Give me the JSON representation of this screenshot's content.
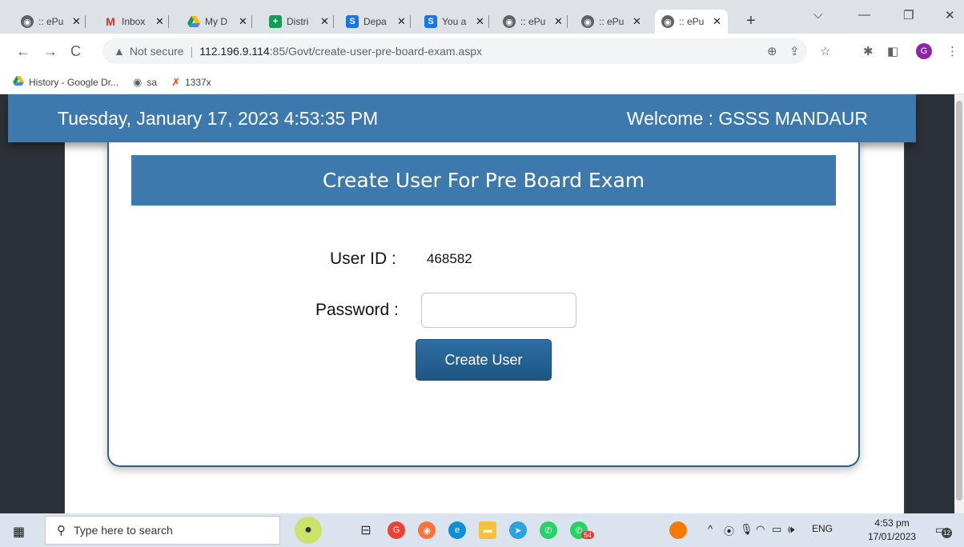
{
  "browser": {
    "tabs": [
      {
        "label": ":: ePu",
        "icon": "globe-icon"
      },
      {
        "label": "Inbox",
        "icon": "gmail-icon"
      },
      {
        "label": "My D",
        "icon": "drive-icon"
      },
      {
        "label": "Distri",
        "icon": "plus-sheet-icon"
      },
      {
        "label": "Depa",
        "icon": "s-app-icon"
      },
      {
        "label": "You a",
        "icon": "s-app-icon"
      },
      {
        "label": ":: ePu",
        "icon": "globe-icon"
      },
      {
        "label": ":: ePu",
        "icon": "globe-icon"
      },
      {
        "label": ":: ePu",
        "icon": "globe-icon"
      }
    ],
    "address": {
      "security_label": "Not secure",
      "url_host": "112.196.9.114",
      "url_rest": ":85/Govt/create-user-pre-board-exam.aspx"
    },
    "profile_initial": "G",
    "bookmarks": [
      {
        "label": "History - Google Dr...",
        "icon": "drive-icon"
      },
      {
        "label": "sa",
        "icon": "globe-icon"
      },
      {
        "label": "1337x",
        "icon": "x-icon"
      }
    ]
  },
  "page": {
    "datetime": "Tuesday, January 17, 2023 4:53:35 PM",
    "welcome": "Welcome : GSSS MANDAUR",
    "form_title": "Create User For Pre Board Exam",
    "user_id_label": "User ID :",
    "user_id_value": "468582",
    "password_label": "Password :",
    "password_value": "",
    "create_button": "Create User"
  },
  "taskbar": {
    "search_placeholder": "Type here to search",
    "whatsapp_badge": "54",
    "language": "ENG",
    "time": "4:53 pm",
    "date": "17/01/2023",
    "notification_count": "12"
  },
  "colors": {
    "header_blue": "#3e79ad",
    "button_blue": "#1e5684"
  }
}
